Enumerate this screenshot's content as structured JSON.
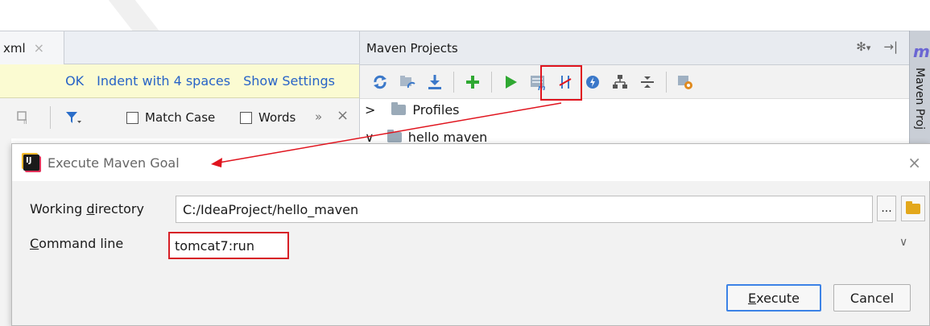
{
  "editor": {
    "tab_label": "xml",
    "tab_close": "×"
  },
  "notification": {
    "ok": "OK",
    "indent": "Indent with 4 spaces",
    "show_settings": "Show Settings"
  },
  "search_bar": {
    "match_case_label": "Match Case",
    "words_label": "Words",
    "more_symbol": "»",
    "close_symbol": "×"
  },
  "maven_panel": {
    "title": "Maven Projects",
    "settings_symbol": "✻",
    "dropdown_symbol": "▾",
    "hide_symbol": "→|",
    "tree": [
      {
        "label": "Profiles",
        "expander": ">"
      },
      {
        "label": "hello maven",
        "expander": "∨"
      }
    ]
  },
  "side_strip": {
    "icon_letter": "m",
    "label": "Maven Proj"
  },
  "dialog": {
    "title": "Execute Maven Goal",
    "close_symbol": "×",
    "working_directory_label": "Working directory",
    "working_directory_value": "C:/IdeaProject/hello_maven",
    "browse_label": "...",
    "command_line_label": "Command line",
    "command_line_value": "tomcat7:run",
    "combo_arrow": "∨",
    "execute_label": "Execute",
    "cancel_label": "Cancel"
  },
  "colors": {
    "highlight_red": "#e0141e",
    "link_blue": "#2763c7",
    "run_green": "#2fa832",
    "focus_blue": "#3c82e6"
  },
  "icons": {
    "toolbar": [
      "refresh-icon",
      "reimport-icon",
      "download-icon",
      "add-icon",
      "run-icon",
      "execute-goal-icon",
      "toggle-offline-icon",
      "lifecycle-icon",
      "show-dependencies-icon",
      "collapse-icon",
      "maven-settings-icon"
    ]
  }
}
